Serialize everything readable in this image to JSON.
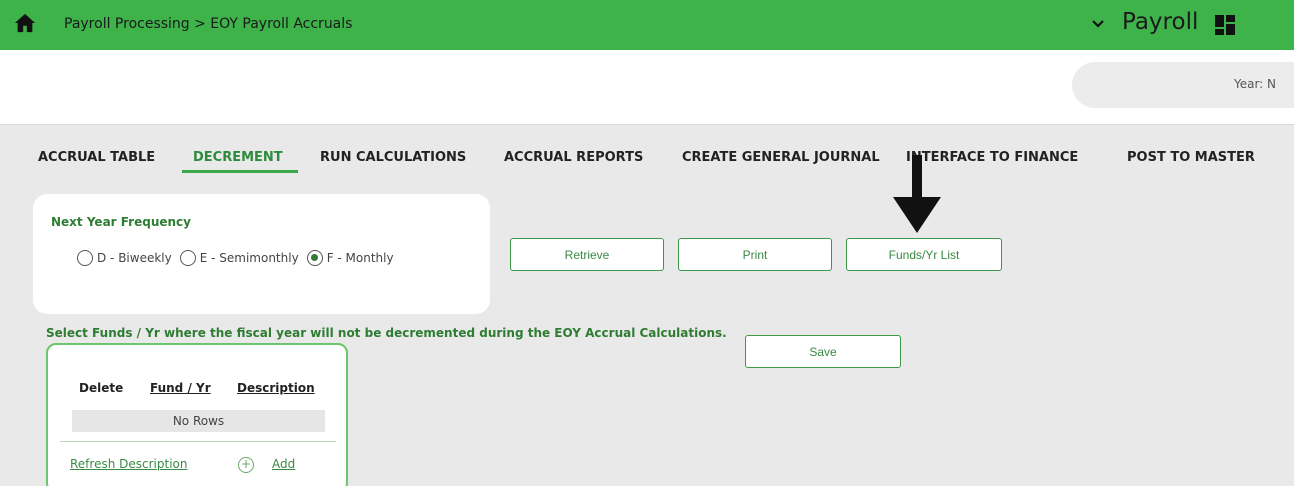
{
  "header": {
    "breadcrumb": "Payroll Processing > EOY Payroll Accruals",
    "module": "Payroll",
    "home_icon": "home-icon",
    "chevron_icon": "chevron-down-icon",
    "grid_icon": "grid-icon",
    "background": "#3db34a"
  },
  "subheader": {
    "year_label": "Year: N"
  },
  "tabs": [
    {
      "label": "ACCRUAL TABLE",
      "active": false
    },
    {
      "label": "DECREMENT",
      "active": true
    },
    {
      "label": "RUN CALCULATIONS",
      "active": false
    },
    {
      "label": "ACCRUAL REPORTS",
      "active": false
    },
    {
      "label": "CREATE GENERAL JOURNAL",
      "active": false
    },
    {
      "label": "INTERFACE TO FINANCE",
      "active": false
    },
    {
      "label": "POST TO MASTER",
      "active": false
    }
  ],
  "frequency": {
    "title": "Next Year Frequency",
    "options": [
      {
        "label": "D - Biweekly",
        "selected": false
      },
      {
        "label": "E - Semimonthly",
        "selected": false
      },
      {
        "label": "F - Monthly",
        "selected": true
      }
    ]
  },
  "buttons": {
    "retrieve": "Retrieve",
    "print": "Print",
    "funds_list": "Funds/Yr List",
    "save": "Save"
  },
  "instruction": "Select Funds / Yr where the fiscal year will not be decremented during the EOY Accrual Calculations.",
  "funds_table": {
    "headers": [
      "Delete",
      "Fund / Yr",
      "Description"
    ],
    "empty_text": "No Rows",
    "refresh_link": "Refresh Description",
    "add_link": "Add"
  },
  "colors": {
    "accent": "#3db34a",
    "text_green": "#2e7d32"
  }
}
